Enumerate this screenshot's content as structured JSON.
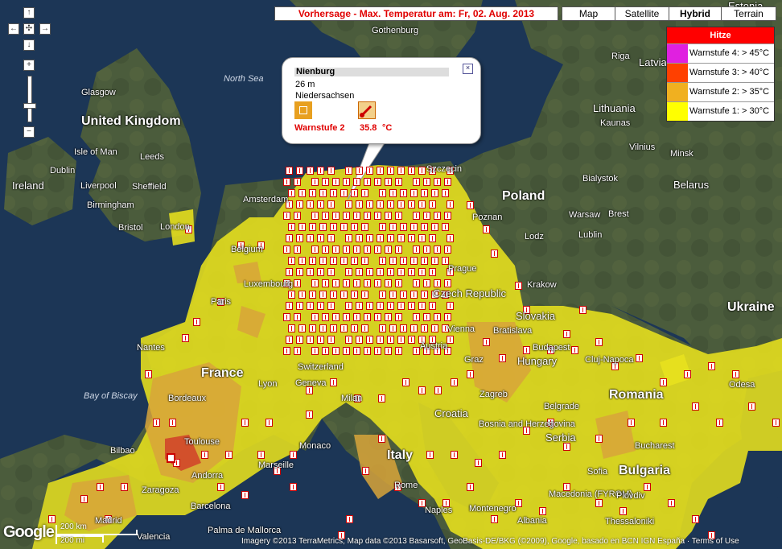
{
  "header": {
    "title": "Vorhersage - Max. Temperatur am: Fr, 02. Aug. 2013"
  },
  "map_types": [
    {
      "label": "Map",
      "active": false
    },
    {
      "label": "Satellite",
      "active": false
    },
    {
      "label": "Hybrid",
      "active": true
    },
    {
      "label": "Terrain",
      "active": false
    }
  ],
  "legend": {
    "title": "Hitze",
    "items": [
      {
        "label": "Warnstufe 4: > 45°C",
        "color": "#e020e0"
      },
      {
        "label": "Warnstufe 3: > 40°C",
        "color": "#ff4000"
      },
      {
        "label": "Warnstufe 2: > 35°C",
        "color": "#f0b020"
      },
      {
        "label": "Warnstufe 1: > 30°C",
        "color": "#ffff00"
      }
    ]
  },
  "colors": {
    "heat1": "#e8e11e",
    "heat2": "#d8a43a",
    "heat3": "#d2462a",
    "water": "#1c3656",
    "land": "#4a5a3a"
  },
  "info_window": {
    "name": "Nienburg",
    "elevation": "26 m",
    "region": "Niedersachsen",
    "warn_label": "Warnstufe 2",
    "temperature": "35.8",
    "unit": "°C"
  },
  "places": [
    "Estonia",
    "Latvia",
    "Riga",
    "Lithuania",
    "Kaunas",
    "Vilnius",
    "Minsk",
    "Belarus",
    "Bialystok",
    "Brest",
    "Poland",
    "Warsaw",
    "Lublin",
    "Lodz",
    "Poznan",
    "Szczecin",
    "Krakow",
    "Ukraine",
    "Gothenburg",
    "North Sea",
    "Glasgow",
    "United Kingdom",
    "Isle of Man",
    "Leeds",
    "Dublin",
    "Ireland",
    "Liverpool",
    "Sheffield",
    "Birmingham",
    "Bristol",
    "London",
    "Amsterdam",
    "Belgium",
    "Luxembourg",
    "Paris",
    "France",
    "Nantes",
    "Bay of Biscay",
    "Bordeaux",
    "Toulouse",
    "Bilbao",
    "Madrid",
    "Zaragoza",
    "Barcelona",
    "Andorra",
    "Palma de Mallorca",
    "Valencia",
    "Lyon",
    "Geneva",
    "Monaco",
    "Marseille",
    "Switzerland",
    "Italy",
    "Rome",
    "Naples",
    "Milan",
    "Austria",
    "Vienna",
    "Bratislava",
    "Prague",
    "Czech Republic",
    "Hungary",
    "Budapest",
    "Slovakia",
    "Croatia",
    "Zagreb",
    "Graz",
    "Bosnia and Herzegovina",
    "Serbia",
    "Belgrade",
    "Romania",
    "Bucharest",
    "Cluj-Napoca",
    "Bulgaria",
    "Sofia",
    "Montenegro",
    "Macedonia (FYROM)",
    "Albania",
    "Thessaloniki",
    "Odesa",
    "Plovdiv"
  ],
  "scale": {
    "km": "200 km",
    "mi": "200 mi"
  },
  "attribution": "Imagery ©2013 TerraMetrics, Map data ©2013 Basarsoft, GeoBasis-DE/BKG (©2009), Google, basado en BCN IGN España · Terms of Use",
  "logo": "Google"
}
